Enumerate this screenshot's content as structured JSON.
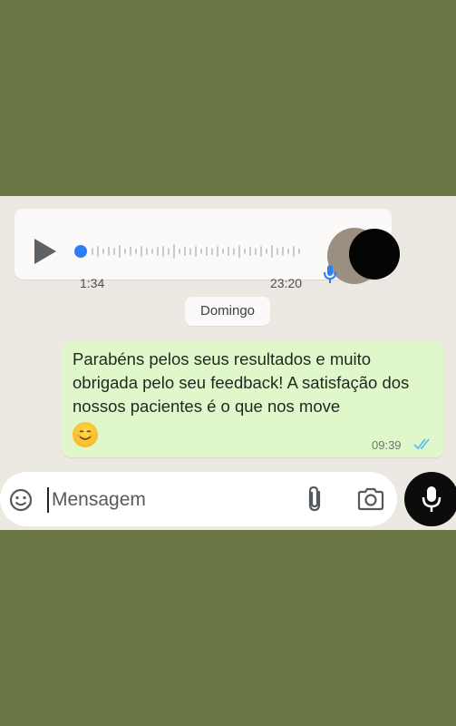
{
  "voice_message": {
    "duration": "1:34",
    "time": "23:20",
    "progress": 0
  },
  "date_separator": "Domingo",
  "message": {
    "text": "Parabéns pelos seus resultados e muito obrigada pelo seu feedback! A satisfação dos nossos pacientes é o que nos move",
    "emoji": "😊",
    "time": "09:39",
    "status": "read"
  },
  "composer": {
    "placeholder": "Mensagem"
  },
  "icons": {
    "play": "play-icon",
    "voice_mic": "microphone-icon",
    "emoji": "sticker-icon",
    "attach": "paperclip-icon",
    "camera": "camera-icon",
    "send_voice": "microphone-icon"
  },
  "colors": {
    "background": "#6b7645",
    "chat_background": "#ece8e2",
    "incoming_bubble": "#fbfaf9",
    "outgoing_bubble": "#dff7ca",
    "read_ticks": "#53bdeb",
    "voice_accent": "#2d7df6",
    "mic_button": "#0c0c0c"
  }
}
